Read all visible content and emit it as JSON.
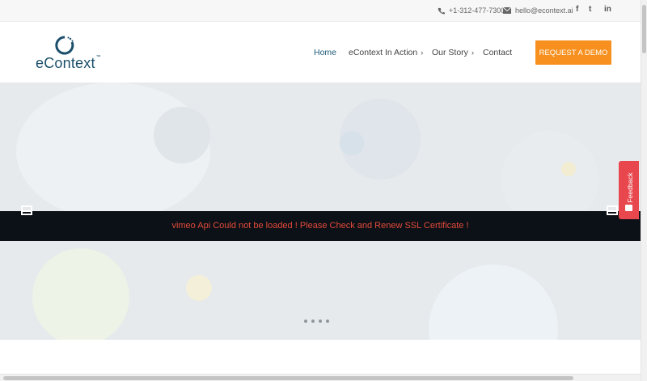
{
  "topbar": {
    "phone": "+1-312-477-7300",
    "email": "hello@econtext.ai",
    "phone_icon": "phone-icon",
    "email_icon": "envelope-icon",
    "social": {
      "facebook": "f",
      "twitter": "t",
      "linkedin": "in"
    }
  },
  "header": {
    "logo_text": "eContext",
    "logo_tm": "™",
    "nav": {
      "home": "Home",
      "action": "eContext In Action",
      "story": "Our Story",
      "contact": "Contact"
    },
    "cta": "REQUEST A DEMO"
  },
  "hero": {
    "error_message": "vimeo Api Could not be loaded ! Please Check and Renew SSL Certificate !",
    "slide_count": 4
  },
  "feedback": {
    "label": "Feedback"
  },
  "colors": {
    "accent": "#f7901e",
    "brand": "#1b4f6b",
    "error": "#e34a3a",
    "feedback": "#e8474d"
  }
}
